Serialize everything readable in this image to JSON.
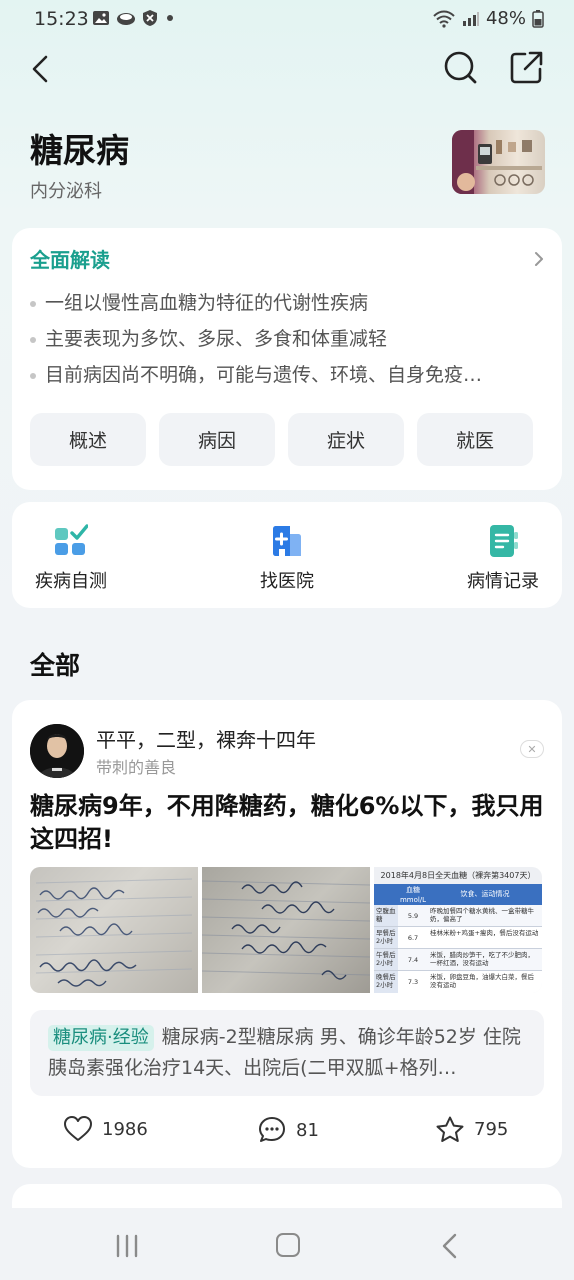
{
  "status_bar": {
    "time": "15:23",
    "battery": "48%",
    "left_icons": [
      "gallery-icon",
      "cloud-icon",
      "shield-icon",
      "dot-icon"
    ],
    "right_icons": [
      "wifi-icon",
      "signal-icon",
      "battery-icon"
    ]
  },
  "header": {
    "title": "糖尿病",
    "department": "内分泌科"
  },
  "summary": {
    "title": "全面解读",
    "bullets": [
      "一组以慢性高血糖为特征的代谢性疾病",
      "主要表现为多饮、多尿、多食和体重减轻",
      "目前病因尚不明确，可能与遗传、环境、自身免疫…"
    ],
    "tags": [
      "概述",
      "病因",
      "症状",
      "就医"
    ]
  },
  "tools": [
    {
      "label": "疾病自测",
      "icon": "self-test-icon"
    },
    {
      "label": "找医院",
      "icon": "hospital-icon"
    },
    {
      "label": "病情记录",
      "icon": "record-icon"
    }
  ],
  "section_title": "全部",
  "post": {
    "author": "平平，二型，裸奔十四年",
    "author_sub": "带刺的善良",
    "title": "糖尿病9年，不用降糖药，糖化6%以下，我只用这四招!",
    "excerpt_tag": "糖尿病·经验",
    "excerpt": "糖尿病-2型糖尿病 男、确诊年龄52岁 住院胰岛素强化治疗14天、出院后(二甲双胍+格列…",
    "likes": "1986",
    "comments": "81",
    "favorites": "795",
    "image3": {
      "title": "2018年4月8日全天血糖（裸奔第3407天）",
      "headers": [
        "",
        "血糖 mmol/L",
        "饮食、运动情况"
      ],
      "rows": [
        [
          "空腹血糖",
          "5.9",
          "昨晚加餐四个糖水黄桃、一盒带糖牛奶，偏高了"
        ],
        [
          "早餐后2小时",
          "6.7",
          "桂林米粉+鸡蛋+瘦肉，餐后没有运动"
        ],
        [
          "午餐后2小时",
          "7.4",
          "米饭，腊肉炒笋干，吃了不少肥肉，一杯红酒，没有运动"
        ],
        [
          "晚餐后2小时",
          "7.3",
          "米饭，卵盘豆角，油爆大白菜，餐后没有运动"
        ]
      ]
    }
  },
  "colors": {
    "accent": "#1a9f8e",
    "tag_bg": "#d6f1ec",
    "card_bg": "#ffffff",
    "page_bg": "#f1f3f6"
  }
}
